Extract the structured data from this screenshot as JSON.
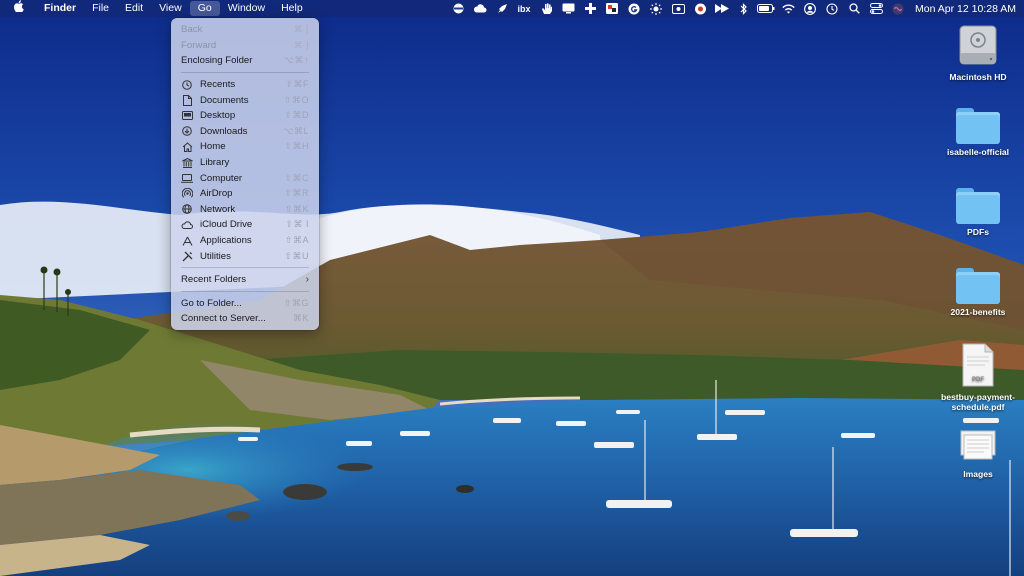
{
  "menubar": {
    "app_name": "Finder",
    "menus": [
      "File",
      "Edit",
      "View",
      "Go",
      "Window",
      "Help"
    ],
    "active_menu": "Go",
    "status_icons": [
      "display-icon",
      "cloud-icon",
      "rocket-icon",
      "ibx-text",
      "hand-icon",
      "monitor-icon",
      "plus-icon",
      "media-icon",
      "grammarly-icon",
      "brightness-icon",
      "screen-icon",
      "compass-icon",
      "forward-icon",
      "bluetooth-icon",
      "battery-icon",
      "wifi-icon",
      "user-icon",
      "time-machine-icon",
      "spotlight-icon",
      "control-center-icon",
      "siri-icon"
    ],
    "ibx_text": "ibx",
    "clock": "Mon Apr 12  10:28 AM"
  },
  "go_menu": {
    "items": [
      {
        "label": "Back",
        "shortcut": "⌘ [",
        "disabled": true,
        "icon": ""
      },
      {
        "label": "Forward",
        "shortcut": "⌘ ]",
        "disabled": true,
        "icon": ""
      },
      {
        "label": "Enclosing Folder",
        "shortcut": "⌥⌘↑",
        "disabled": false,
        "icon": ""
      },
      {
        "sep": true
      },
      {
        "label": "Recents",
        "shortcut": "⇧⌘F",
        "icon": "clock-icon"
      },
      {
        "label": "Documents",
        "shortcut": "⇧⌘O",
        "icon": "document-icon"
      },
      {
        "label": "Desktop",
        "shortcut": "⇧⌘D",
        "icon": "desktop-icon"
      },
      {
        "label": "Downloads",
        "shortcut": "⌥⌘L",
        "icon": "download-icon"
      },
      {
        "label": "Home",
        "shortcut": "⇧⌘H",
        "icon": "home-icon"
      },
      {
        "label": "Library",
        "shortcut": "",
        "icon": "library-icon"
      },
      {
        "label": "Computer",
        "shortcut": "⇧⌘C",
        "icon": "laptop-icon"
      },
      {
        "label": "AirDrop",
        "shortcut": "⇧⌘R",
        "icon": "airdrop-icon"
      },
      {
        "label": "Network",
        "shortcut": "⇧⌘K",
        "icon": "globe-icon"
      },
      {
        "label": "iCloud Drive",
        "shortcut": "⇧⌘ I",
        "icon": "cloud-icon"
      },
      {
        "label": "Applications",
        "shortcut": "⇧⌘A",
        "icon": "applications-icon"
      },
      {
        "label": "Utilities",
        "shortcut": "⇧⌘U",
        "icon": "utilities-icon"
      },
      {
        "sep": true
      },
      {
        "label": "Recent Folders",
        "submenu": true
      },
      {
        "sep": true
      },
      {
        "label": "Go to Folder...",
        "shortcut": "⇧⌘G"
      },
      {
        "label": "Connect to Server...",
        "shortcut": "⌘K"
      }
    ]
  },
  "desktop": {
    "icons": [
      {
        "label": "Macintosh HD",
        "type": "drive"
      },
      {
        "label": "isabelle-official",
        "type": "folder"
      },
      {
        "label": "PDFs",
        "type": "folder"
      },
      {
        "label": "2021-benefits",
        "type": "folder"
      },
      {
        "label": "bestbuy-payment-schedule.pdf",
        "type": "pdf",
        "badge": "PDF"
      },
      {
        "label": "Images",
        "type": "image"
      }
    ]
  }
}
